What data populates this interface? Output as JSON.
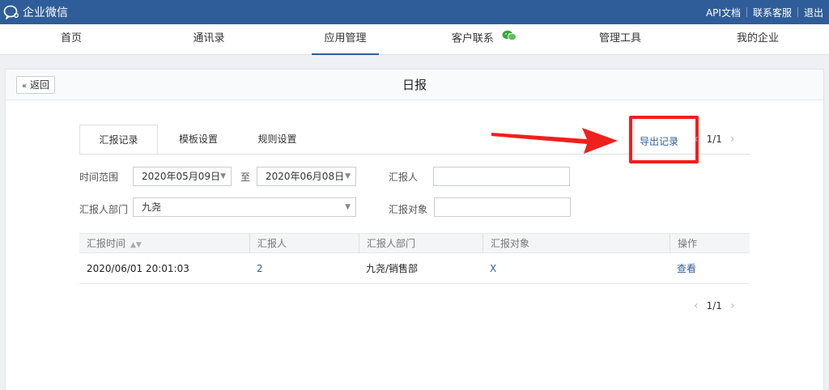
{
  "app": {
    "name": "企业微信"
  },
  "toplinks": [
    "API文档",
    "联系客服",
    "退出"
  ],
  "nav": {
    "items": [
      {
        "label": "首页"
      },
      {
        "label": "通讯录"
      },
      {
        "label": "应用管理"
      },
      {
        "label": "客户联系"
      },
      {
        "label": "管理工具"
      },
      {
        "label": "我的企业"
      }
    ],
    "active": "应用管理"
  },
  "panel": {
    "back_label": "返回",
    "title": "日报"
  },
  "tabs": [
    {
      "label": "汇报记录"
    },
    {
      "label": "模板设置"
    },
    {
      "label": "规则设置"
    }
  ],
  "export_label": "导出记录",
  "pager": {
    "text": "1/1"
  },
  "filters": {
    "time_range_label": "时间范围",
    "start_date": "2020年05月09日",
    "to_label": "至",
    "end_date": "2020年06月08日",
    "reporter_label": "汇报人",
    "reporter_dept_label": "汇报人部门",
    "reporter_dept_value": "九尧",
    "report_target_label": "汇报对象"
  },
  "table": {
    "headers": [
      "汇报时间",
      "汇报人",
      "汇报人部门",
      "汇报对象",
      "操作"
    ],
    "rows": [
      {
        "time": "2020/06/01 20:01:03",
        "reporter": "2",
        "dept": "九尧/销售部",
        "target": "X",
        "action": "查看"
      }
    ]
  },
  "colors": {
    "topbar": "#2f5d99",
    "link": "#2f5d99",
    "highlight": "#f0201c"
  }
}
